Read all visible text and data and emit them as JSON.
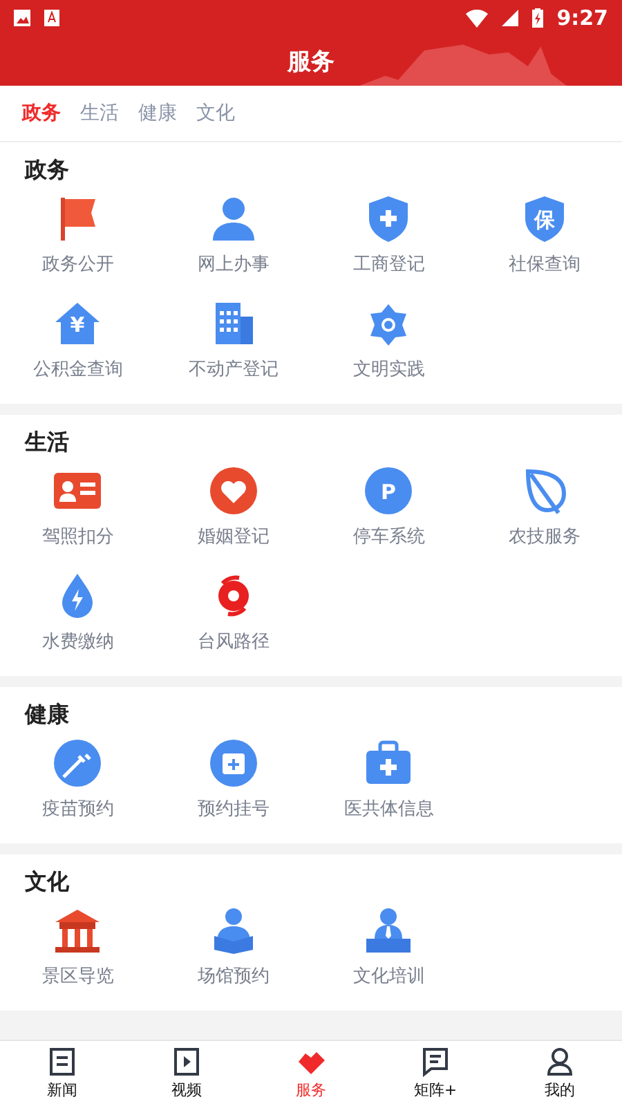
{
  "status_bar": {
    "time": "9:27"
  },
  "header": {
    "title": "服务"
  },
  "tabs": [
    {
      "label": "政务",
      "selected": true
    },
    {
      "label": "生活",
      "selected": false
    },
    {
      "label": "健康",
      "selected": false
    },
    {
      "label": "文化",
      "selected": false
    }
  ],
  "sections": [
    {
      "title": "政务",
      "items": [
        {
          "label": "政务公开",
          "kind": "flag"
        },
        {
          "label": "网上办事",
          "kind": "person"
        },
        {
          "label": "工商登记",
          "kind": "shield"
        },
        {
          "label": "社保查询",
          "kind": "shield",
          "glyph": "保"
        },
        {
          "label": "公积金查询",
          "kind": "house",
          "glyph": "¥"
        },
        {
          "label": "不动产登记",
          "kind": "building"
        },
        {
          "label": "文明实践",
          "kind": "flower"
        }
      ]
    },
    {
      "title": "生活",
      "items": [
        {
          "label": "驾照扣分",
          "kind": "idcard"
        },
        {
          "label": "婚姻登记",
          "kind": "heart"
        },
        {
          "label": "停车系统",
          "kind": "circle",
          "glyph": "P"
        },
        {
          "label": "农技服务",
          "kind": "leaf"
        },
        {
          "label": "水费缴纳",
          "kind": "drop"
        },
        {
          "label": "台风路径",
          "kind": "typhoon"
        }
      ]
    },
    {
      "title": "健康",
      "items": [
        {
          "label": "疫苗预约",
          "kind": "syringe"
        },
        {
          "label": "预约挂号",
          "kind": "calendar"
        },
        {
          "label": "医共体信息",
          "kind": "medkit"
        }
      ]
    },
    {
      "title": "文化",
      "items": [
        {
          "label": "景区导览",
          "kind": "temple"
        },
        {
          "label": "场馆预约",
          "kind": "reader"
        },
        {
          "label": "文化培训",
          "kind": "teacher"
        }
      ]
    }
  ],
  "bottom_nav": [
    {
      "label": "新闻",
      "kind": "news",
      "selected": false
    },
    {
      "label": "视频",
      "kind": "video",
      "selected": false
    },
    {
      "label": "服务",
      "kind": "heart",
      "selected": true
    },
    {
      "label": "矩阵+",
      "kind": "chat",
      "selected": false
    },
    {
      "label": "我的",
      "kind": "user",
      "selected": false
    }
  ]
}
